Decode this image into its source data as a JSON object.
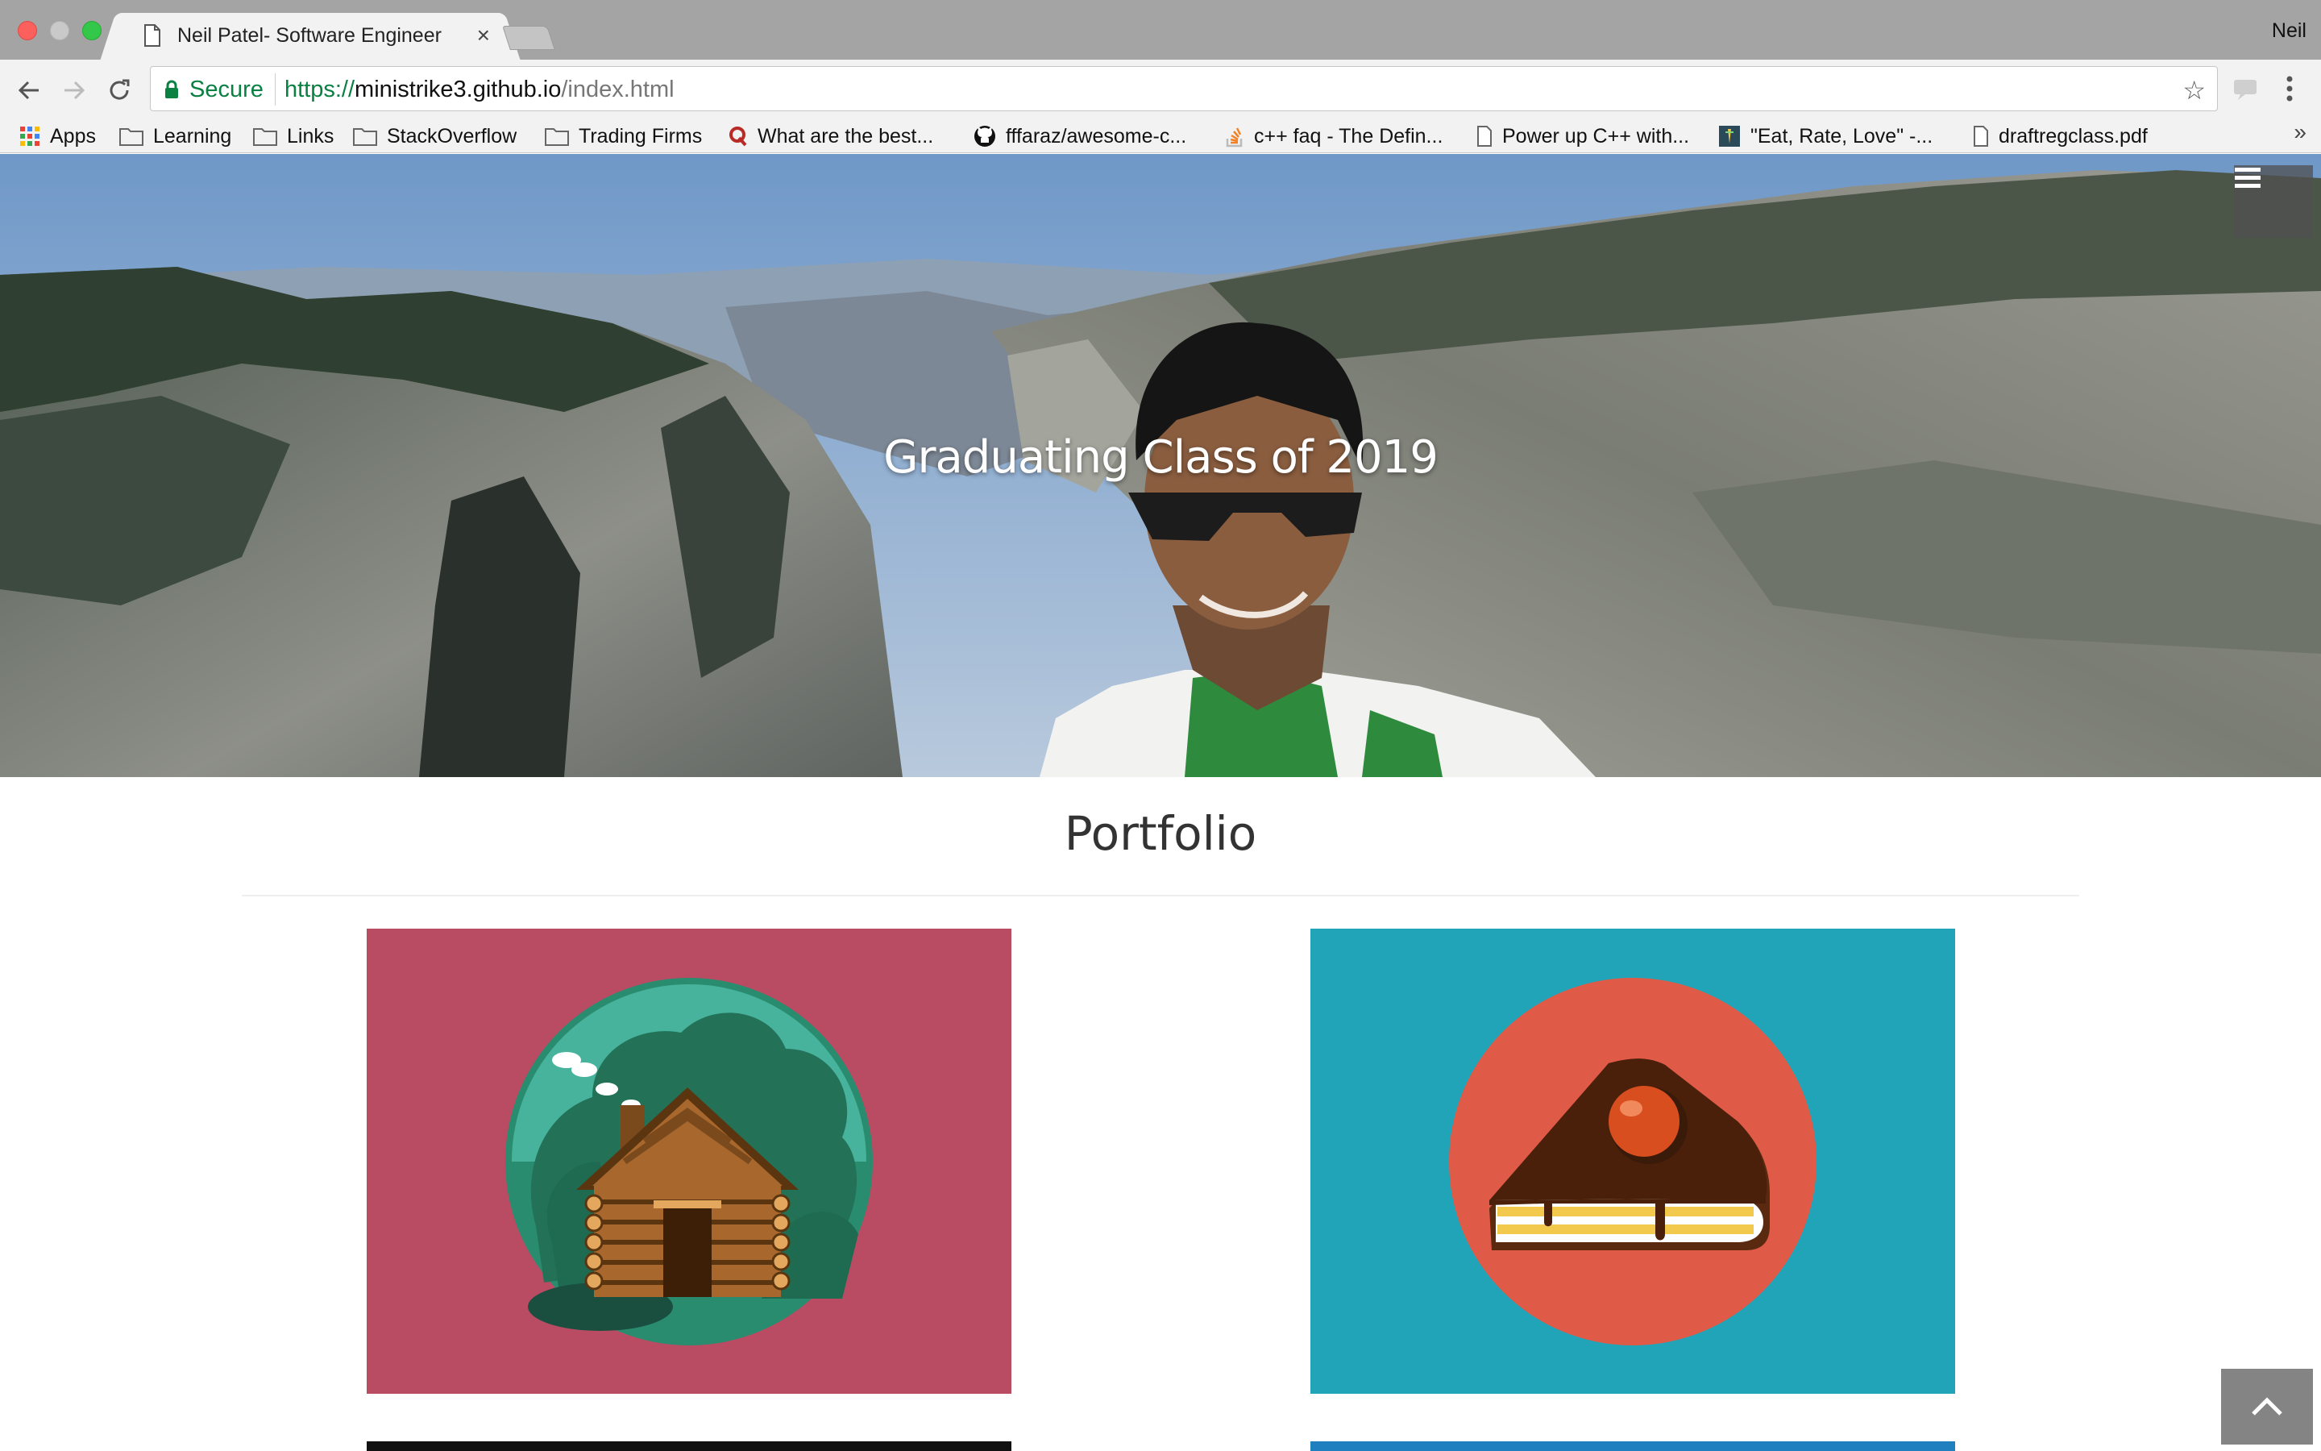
{
  "browser": {
    "tab_title": "Neil Patel- Software Engineer",
    "tab_close": "×",
    "profile_name": "Neil",
    "security_label": "Secure",
    "url_scheme": "https://",
    "url_host": "ministrike3.github.io",
    "url_path": "/index.html",
    "bookmarks": [
      {
        "label": "Apps",
        "icon": "apps-grid-icon"
      },
      {
        "label": "Learning",
        "icon": "folder-icon"
      },
      {
        "label": "Links",
        "icon": "folder-icon"
      },
      {
        "label": "StackOverflow",
        "icon": "folder-icon"
      },
      {
        "label": "Trading Firms",
        "icon": "folder-icon"
      },
      {
        "label": "What are the best...",
        "icon": "quora-icon"
      },
      {
        "label": "fffaraz/awesome-c...",
        "icon": "github-icon"
      },
      {
        "label": "c++ faq - The Defin...",
        "icon": "stackoverflow-icon"
      },
      {
        "label": "Power up C++ with...",
        "icon": "page-icon"
      },
      {
        "label": "\"Eat, Rate, Love\" -...",
        "icon": "site-icon"
      },
      {
        "label": "draftregclass.pdf",
        "icon": "page-icon"
      }
    ],
    "bookmarks_overflow": "»"
  },
  "hero": {
    "title": "Graduating Class of 2019"
  },
  "portfolio": {
    "title": "Portfolio",
    "tiles": [
      {
        "name": "cabin",
        "color": "#b94c63"
      },
      {
        "name": "cake",
        "color": "#21a4b8"
      }
    ]
  },
  "colors": {
    "secure_green": "#0b8043",
    "cabin_tile": "#b94c63",
    "cake_tile": "#21a4b8"
  }
}
